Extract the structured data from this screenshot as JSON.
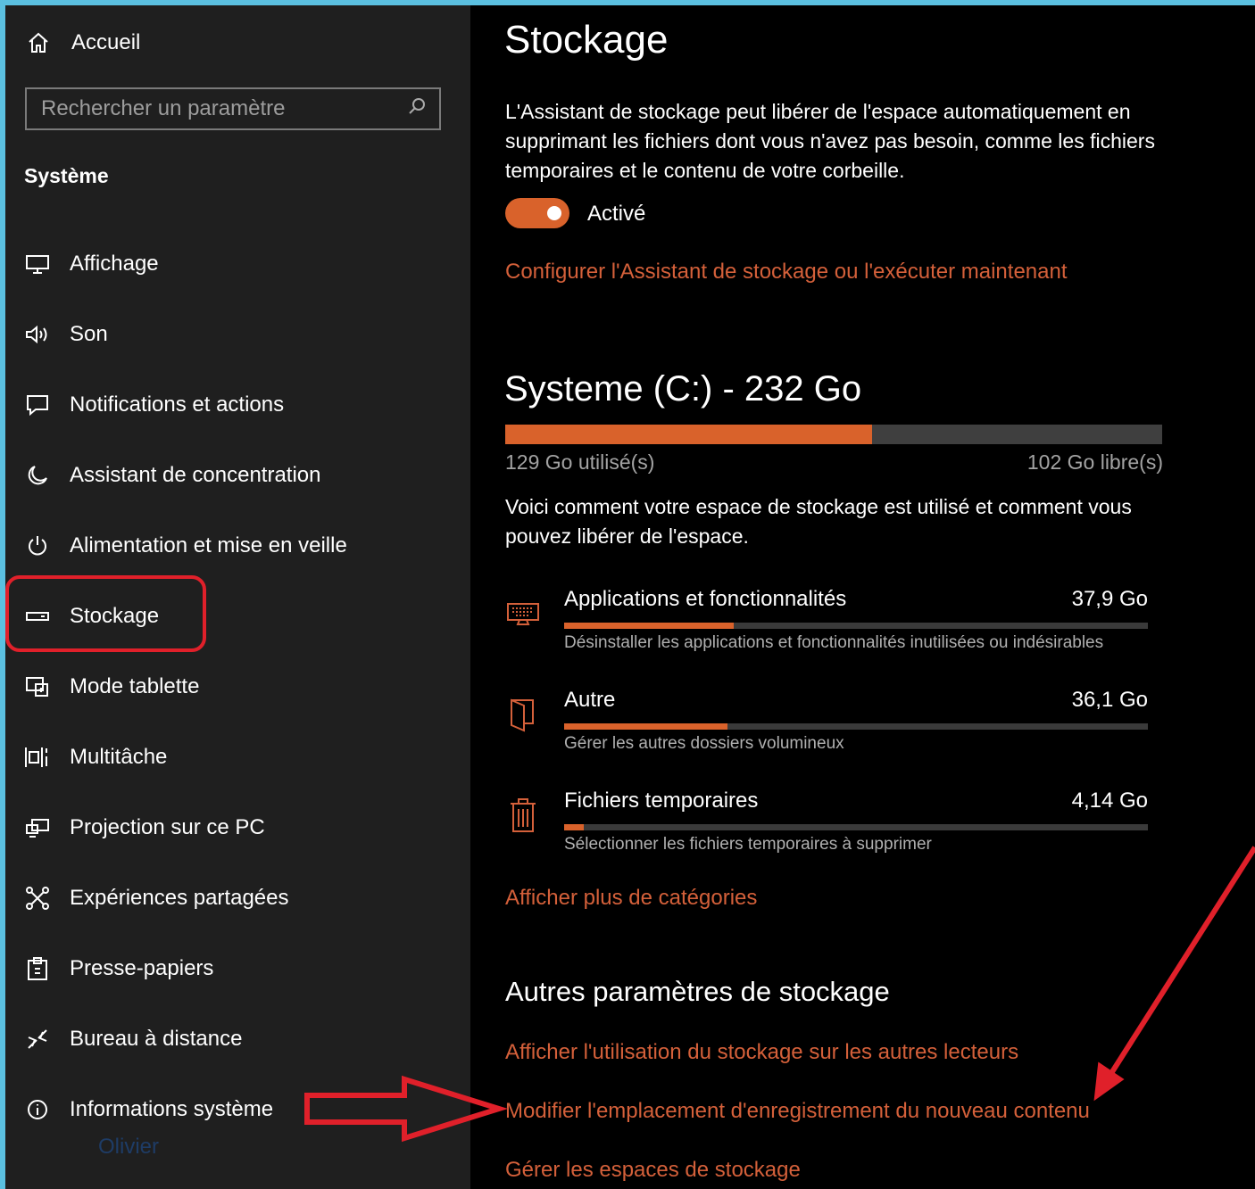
{
  "sidebar": {
    "home_label": "Accueil",
    "search_placeholder": "Rechercher un paramètre",
    "section_title": "Système",
    "items": [
      {
        "label": "Affichage",
        "icon": "display-icon"
      },
      {
        "label": "Son",
        "icon": "speaker-icon"
      },
      {
        "label": "Notifications et actions",
        "icon": "notification-icon"
      },
      {
        "label": "Assistant de concentration",
        "icon": "moon-icon"
      },
      {
        "label": "Alimentation et mise en veille",
        "icon": "power-icon"
      },
      {
        "label": "Stockage",
        "icon": "storage-icon"
      },
      {
        "label": "Mode tablette",
        "icon": "tablet-icon"
      },
      {
        "label": "Multitâche",
        "icon": "multitask-icon"
      },
      {
        "label": "Projection sur ce PC",
        "icon": "projection-icon"
      },
      {
        "label": "Expériences partagées",
        "icon": "shared-icon"
      },
      {
        "label": "Presse-papiers",
        "icon": "clipboard-icon"
      },
      {
        "label": "Bureau à distance",
        "icon": "remote-icon"
      },
      {
        "label": "Informations système",
        "icon": "info-icon"
      }
    ],
    "watermark": "Olivier"
  },
  "main": {
    "title": "Stockage",
    "storage_sense_description": "L'Assistant de stockage peut libérer de l'espace automatiquement en supprimant les fichiers dont vous n'avez pas besoin, comme les fichiers temporaires et le contenu de votre corbeille.",
    "toggle_label": "Activé",
    "toggle_on": true,
    "configure_link": "Configurer l'Assistant de stockage ou l'exécuter maintenant",
    "drive": {
      "title": "Systeme (C:) - 232 Go",
      "used_label": "129 Go utilisé(s)",
      "free_label": "102 Go libre(s)",
      "used_fraction": 0.558
    },
    "usage_description": "Voici comment votre espace de stockage est utilisé et comment vous pouvez libérer de l'espace.",
    "categories": [
      {
        "name": "Applications et fonctionnalités",
        "size": "37,9 Go",
        "description": "Désinstaller les applications et fonctionnalités inutilisées ou indésirables",
        "fraction": 0.29,
        "icon": "keyboard-icon"
      },
      {
        "name": "Autre",
        "size": "36,1 Go",
        "description": "Gérer les autres dossiers volumineux",
        "fraction": 0.28,
        "icon": "folder-icon"
      },
      {
        "name": "Fichiers temporaires",
        "size": "4,14 Go",
        "description": "Sélectionner les fichiers temporaires à supprimer",
        "fraction": 0.033,
        "icon": "trash-icon"
      }
    ],
    "more_categories_link": "Afficher plus de catégories",
    "other_settings_title": "Autres paramètres de stockage",
    "links": {
      "other_drives": "Afficher l'utilisation du stockage sur les autres lecteurs",
      "save_location": "Modifier l'emplacement d'enregistrement du nouveau contenu",
      "storage_spaces": "Gérer les espaces de stockage"
    },
    "accent_color": "#d9622b",
    "link_color": "#d4603a"
  },
  "annotations": {
    "highlight_color": "#e0202a"
  }
}
